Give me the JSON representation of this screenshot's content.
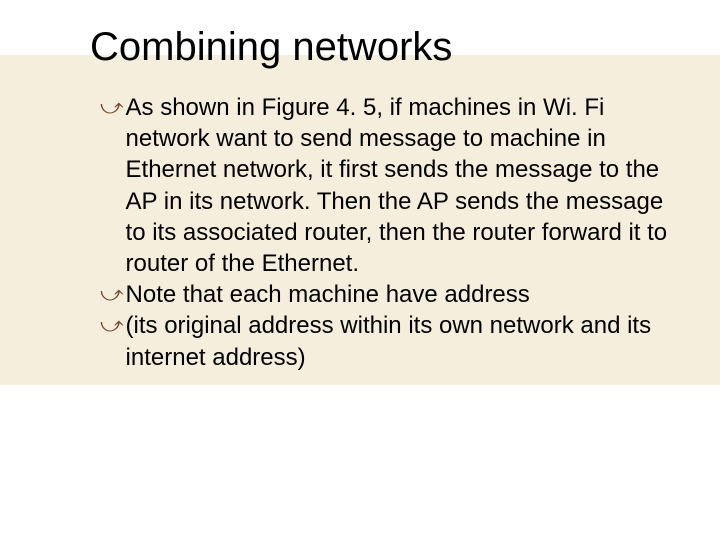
{
  "slide": {
    "title": "Combining networks",
    "bullets": [
      {
        "text": "As shown in Figure 4. 5, if machines in Wi. Fi network want to send message to machine in Ethernet network, it first sends the message to the AP in its network. Then the AP sends the message to its associated router, then the router forward it to router of the Ethernet."
      },
      {
        "text": "Note that each machine have address"
      },
      {
        "text": "(its original address within its own network and its internet address)"
      }
    ]
  }
}
